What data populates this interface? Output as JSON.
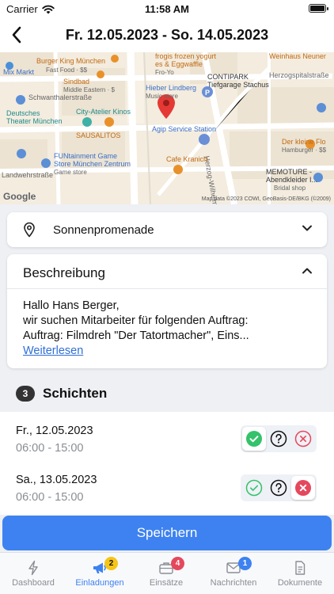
{
  "status_bar": {
    "carrier": "Carrier",
    "time": "11:58 AM"
  },
  "nav": {
    "title": "Fr. 12.05.2023 - So. 14.05.2023",
    "back_icon": "chevron-left-icon"
  },
  "map": {
    "labels": {
      "burger_king": "Burger King München",
      "burger_king_sub": "Fast Food · $$",
      "frogis": "frogis frozen yogurt",
      "frogis_sub": "es & Eggwaffle",
      "frogis_sub2": "Fro-Yo",
      "weinhaus": "Weinhaus Neuner",
      "mix_markt": "Mix Markt",
      "sindbad": "Sindbad",
      "sindbad_sub": "Middle Eastern · $",
      "hieber": "Hieber Lindberg",
      "hieber_sub": "Music store",
      "contipark": "CONTIPARK",
      "contipark_sub": "Tiefgarage Stachus",
      "herzogspital": "Herzogspitalstraße",
      "schwanthaler": "Schwanthalerstraße",
      "city_atelier": "City-Atelier Kinos",
      "deutsches_theater": "Deutsches",
      "deutsches_theater2": "Theater München",
      "agip": "Agip Service Station",
      "sausalitos": "SAUSALITOS",
      "herzog_wilhelm": "Herzog-Wilhelm-Straße",
      "der_kleine_flo": "Der kleine Flo",
      "der_kleine_flo_sub": "Hamburger · $$",
      "funtainment": "FUNtainment Game",
      "funtainment2": "Store München Zentrum",
      "funtainment_sub": "Game store",
      "cafe_kranich": "Cafe Kranich",
      "landwehr": "Landwehrstraße",
      "memoture": "MEMOTURE -",
      "memoture2": "Abendkleider I...",
      "memoture_sub": "Bridal shop",
      "google": "Google",
      "map_data": "Map data ©2023 COWI, GeoBasis-DE/BKG (©2009)"
    }
  },
  "location": {
    "name": "Sonnenpromenade",
    "icon": "map-pin-icon",
    "chevron": "chevron-down-icon"
  },
  "description": {
    "heading": "Beschreibung",
    "line1": "Hallo Hans Berger,",
    "line2": "wir suchen Mitarbeiter für folgenden Auftrag:",
    "line3": "Auftrag: Filmdreh \"Der Tatortmacher\", Eins...",
    "read_more": "Weiterlesen",
    "chevron": "chevron-up-icon"
  },
  "shifts": {
    "count": "3",
    "title": "Schichten",
    "items": [
      {
        "date": "Fr., 12.05.2023",
        "time": "06:00 - 15:00",
        "selected": "accept"
      },
      {
        "date": "Sa., 13.05.2023",
        "time": "06:00 - 15:00",
        "selected": "decline"
      }
    ]
  },
  "save_label": "Speichern",
  "colors": {
    "accent": "#3d82f0",
    "accept": "#34c26b",
    "decline": "#e5485d",
    "badge_yellow": "#f5c518",
    "badge_red": "#e5485d",
    "badge_blue": "#3d82f0"
  },
  "tabs": [
    {
      "label": "Dashboard",
      "icon": "lightning-icon",
      "badge": ""
    },
    {
      "label": "Einladungen",
      "icon": "megaphone-icon",
      "badge": "2"
    },
    {
      "label": "Einsätze",
      "icon": "briefcase-icon",
      "badge": "4"
    },
    {
      "label": "Nachrichten",
      "icon": "envelope-icon",
      "badge": "1"
    },
    {
      "label": "Dokumente",
      "icon": "document-icon",
      "badge": ""
    }
  ]
}
